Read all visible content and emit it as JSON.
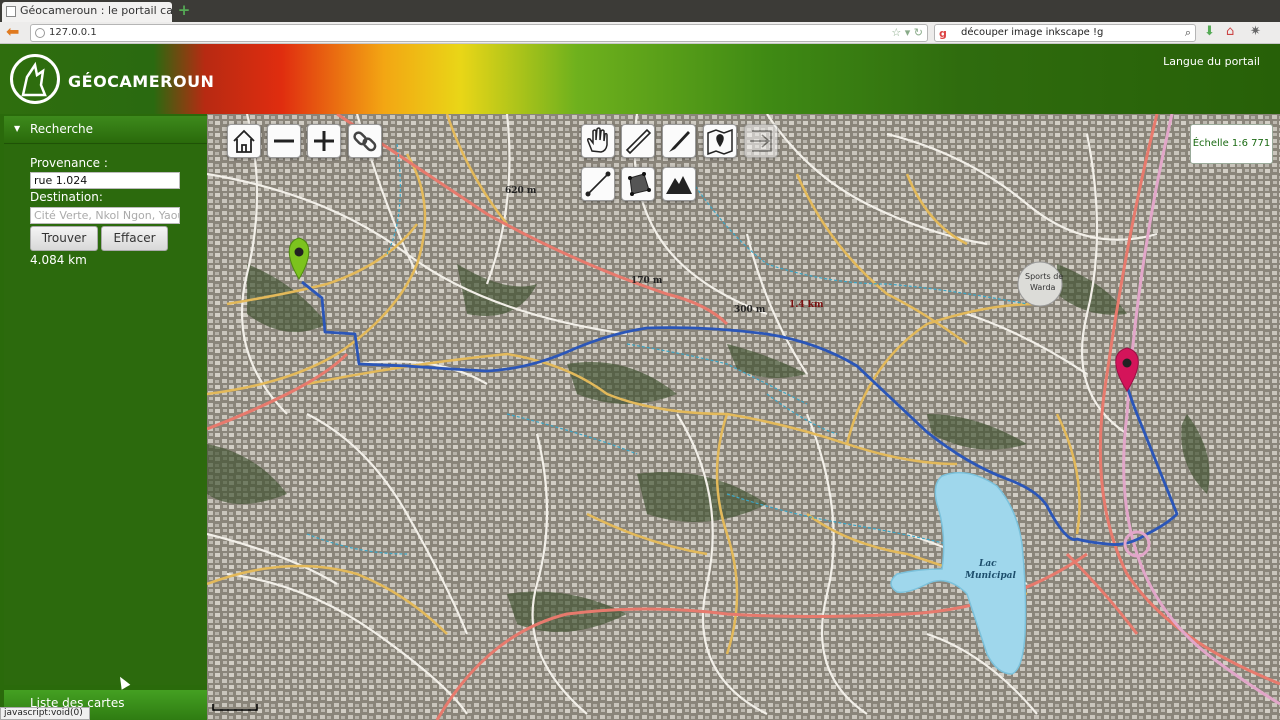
{
  "browser": {
    "tab_title": "Géocameroun : le portail carto...",
    "url": "127.0.0.1",
    "search_text": "découper image inkscape !g"
  },
  "header": {
    "logo_text": "GÉOCAMEROUN",
    "language_link": "Langue du portail"
  },
  "sidebar": {
    "section_title": "Recherche",
    "provenance_label": "Provenance :",
    "provenance_value": "rue 1.024",
    "destination_label": "Destination:",
    "destination_placeholder": "Cité Verte, Nkol Ngon, Yaoundé",
    "find_button": "Trouver",
    "clear_button": "Effacer",
    "distance": "4.084 km",
    "footer_section": "Liste des cartes"
  },
  "status_bar": "javascript:void(0)",
  "map": {
    "scale": "Échelle 1:6 771",
    "lake_label_1": "Lac",
    "lake_label_2": "Municipal",
    "dist_labels": [
      "620 m",
      "170 m",
      "300 m",
      "1.4 km"
    ],
    "tools": [
      "home-icon",
      "zoom-out-icon",
      "zoom-in-icon",
      "link-icon",
      "pan-hand-icon",
      "measure-ruler-icon",
      "draw-pen-icon",
      "map-pin-icon",
      "export-arrow-icon",
      "line-measure-icon",
      "polygon-measure-icon",
      "elevation-profile-icon"
    ],
    "start_marker_color": "#6fbf1e",
    "end_marker_color": "#d4145a",
    "route_color": "#2b56b8"
  }
}
